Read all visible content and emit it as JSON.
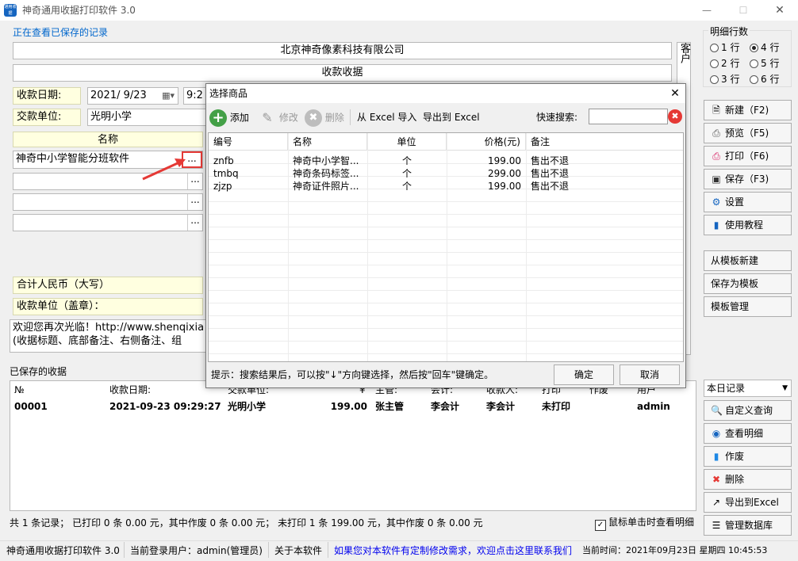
{
  "window": {
    "title": "神奇通用收据打印软件 3.0",
    "app_icon_text": "通用收据"
  },
  "viewing_label": "正在查看已保存的记录",
  "receipt": {
    "company": "北京神奇像素科技有限公司",
    "doc_title": "收款收据",
    "date_label": "收款日期:",
    "date_value": "2021/ 9/23",
    "time_value": "9:2",
    "payer_label": "交款单位:",
    "payer_value": "光明小学",
    "col_name": "名称",
    "item1": "神奇中小学智能分班软件",
    "ellipsis": "...",
    "total_label": "合计人民币（大写）",
    "seal_label": "收款单位（盖章）：",
    "note_line1": "欢迎您再次光临！http://www.shenqixia",
    "note_line2": "(收据标题、底部备注、右侧备注、组",
    "side_text": "客户"
  },
  "right_panel": {
    "rows_title": "明细行数",
    "rows": [
      "1 行",
      "4 行",
      "2 行",
      "5 行",
      "3 行",
      "6 行"
    ],
    "buttons": {
      "new": "新建（F2)",
      "preview": "预览（F5)",
      "print": "打印（F6)",
      "save": "保存（F3)",
      "settings": "设置",
      "tutorial": "使用教程",
      "from_template": "从模板新建",
      "save_template": "保存为模板",
      "template_mgr": "模板管理"
    },
    "filter_value": "本日记录",
    "buttons2": {
      "custom_query": "自定义查询",
      "view_detail": "查看明细",
      "void": "作废",
      "delete": "删除",
      "export": "导出到Excel",
      "manage_db": "管理数据库"
    }
  },
  "saved": {
    "title": "已保存的收据",
    "headers": [
      "№",
      "收款日期:",
      "交款单位:",
      "¥",
      "主管:",
      "会计:",
      "收款人:",
      "打印",
      "作废",
      "用户"
    ],
    "rows": [
      [
        "00001",
        "2021-09-23 09:29:27",
        "光明小学",
        "199.00",
        "张主管",
        "李会计",
        "李会计",
        "未打印",
        "",
        "admin"
      ]
    ],
    "summary": "共 1 条记录；  已打印 0 条 0.00 元，其中作废 0 条 0.00 元；  未打印 1 条 199.00 元，其中作废 0 条 0.00 元",
    "click_detail_label": "鼠标单击时查看明细"
  },
  "statusbar": {
    "app": "神奇通用收据打印软件 3.0",
    "user": "当前登录用户：admin(管理员)",
    "about": "关于本软件",
    "custom_link": "如果您对本软件有定制修改需求，欢迎点击这里联系我们",
    "time": "当前时间：2021年09月23日 星期四 10:45:53"
  },
  "dialog": {
    "title": "选择商品",
    "toolbar": {
      "add": "添加",
      "edit": "修改",
      "delete": "删除",
      "import": "从 Excel 导入",
      "export": "导出到 Excel",
      "search_label": "快速搜索:"
    },
    "headers": [
      "编号",
      "名称",
      "单位",
      "价格(元)",
      "备注"
    ],
    "rows": [
      [
        "znfb",
        "神奇中小学智...",
        "个",
        "199.00",
        "售出不退"
      ],
      [
        "tmbq",
        "神奇条码标签...",
        "个",
        "299.00",
        "售出不退"
      ],
      [
        "zjzp",
        "神奇证件照片...",
        "个",
        "199.00",
        "售出不退"
      ]
    ],
    "hint": "提示：搜索结果后，可以按\"↓\"方向键选择，然后按\"回车\"键确定。",
    "ok": "确定",
    "cancel": "取消"
  },
  "colors": {
    "accent": "#0066cc",
    "link": "#0000ee",
    "warning": "#e53935",
    "label_bg": "#ffffe0"
  }
}
